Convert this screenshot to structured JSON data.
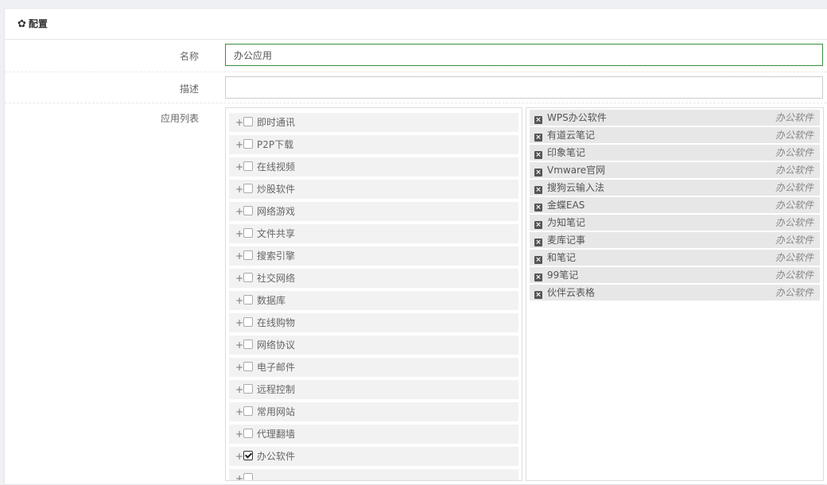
{
  "panel": {
    "title": "配置"
  },
  "form": {
    "name_label": "名称",
    "name_value": "办公应用",
    "desc_label": "描述",
    "desc_value": "",
    "list_label": "应用列表"
  },
  "categories": [
    {
      "label": "即时通讯",
      "checked": false
    },
    {
      "label": "P2P下载",
      "checked": false
    },
    {
      "label": "在线视频",
      "checked": false
    },
    {
      "label": "炒股软件",
      "checked": false
    },
    {
      "label": "网络游戏",
      "checked": false
    },
    {
      "label": "文件共享",
      "checked": false
    },
    {
      "label": "搜索引擎",
      "checked": false
    },
    {
      "label": "社交网络",
      "checked": false
    },
    {
      "label": "数据库",
      "checked": false
    },
    {
      "label": "在线购物",
      "checked": false
    },
    {
      "label": "网络协议",
      "checked": false
    },
    {
      "label": "电子邮件",
      "checked": false
    },
    {
      "label": "远程控制",
      "checked": false
    },
    {
      "label": "常用网站",
      "checked": false
    },
    {
      "label": "代理翻墙",
      "checked": false
    },
    {
      "label": "办公软件",
      "checked": true
    },
    {
      "label": "",
      "checked": false
    }
  ],
  "selected_apps": [
    {
      "name": "WPS办公软件",
      "type": "办公软件"
    },
    {
      "name": "有道云笔记",
      "type": "办公软件"
    },
    {
      "name": "印象笔记",
      "type": "办公软件"
    },
    {
      "name": "Vmware官网",
      "type": "办公软件"
    },
    {
      "name": "搜狗云输入法",
      "type": "办公软件"
    },
    {
      "name": "金蝶EAS",
      "type": "办公软件"
    },
    {
      "name": "为知笔记",
      "type": "办公软件"
    },
    {
      "name": "麦库记事",
      "type": "办公软件"
    },
    {
      "name": "和笔记",
      "type": "办公软件"
    },
    {
      "name": "99笔记",
      "type": "办公软件"
    },
    {
      "name": "伙伴云表格",
      "type": "办公软件"
    }
  ],
  "icons": {
    "header": "gear-icon",
    "remove": "close-icon",
    "expand": "plus-icon"
  }
}
